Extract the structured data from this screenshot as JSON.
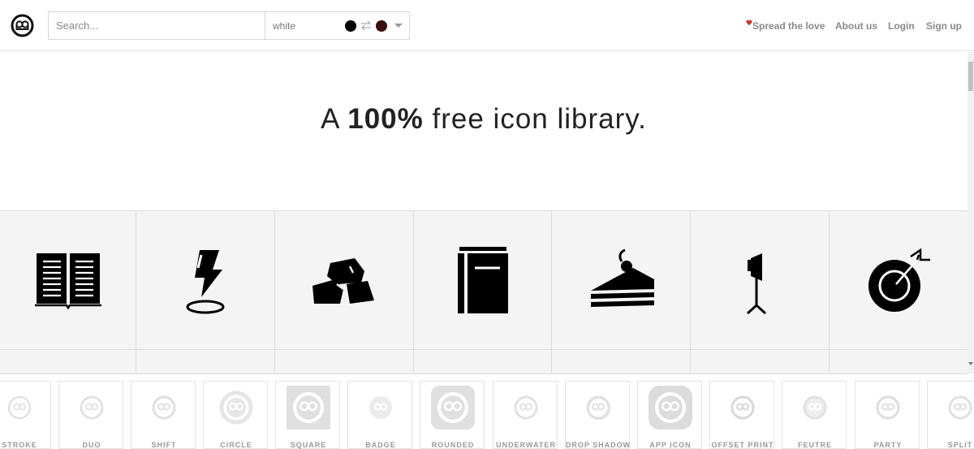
{
  "header": {
    "logo_icon": "circular-dual-loop-logo",
    "search": {
      "placeholder": "Search...",
      "value": ""
    },
    "color_picker": {
      "label": "white",
      "color_a": "#000000",
      "color_b": "#3a0c0c"
    },
    "nav": {
      "spread": "Spread the love",
      "about": "About us",
      "login": "Login",
      "signup": "Sign up"
    }
  },
  "hero": {
    "prefix": "A ",
    "bold": "100%",
    "suffix": " free icon library."
  },
  "icons": [
    {
      "name": "open-book-icon"
    },
    {
      "name": "lightning-marker-icon"
    },
    {
      "name": "rocks-icon"
    },
    {
      "name": "book-icon"
    },
    {
      "name": "cake-slice-icon"
    },
    {
      "name": "studio-light-icon"
    },
    {
      "name": "target-dart-icon"
    }
  ],
  "styles": [
    {
      "label": "STROKE"
    },
    {
      "label": "DUO"
    },
    {
      "label": "SHIFT"
    },
    {
      "label": "CIRCLE"
    },
    {
      "label": "SQUARE"
    },
    {
      "label": "BADGE"
    },
    {
      "label": "ROUNDED"
    },
    {
      "label": "UNDERWATER"
    },
    {
      "label": "DROP SHADOW"
    },
    {
      "label": "APP ICON"
    },
    {
      "label": "OFFSET PRINT"
    },
    {
      "label": "FEUTRE"
    },
    {
      "label": "PARTY"
    },
    {
      "label": "SPLIT"
    }
  ],
  "colors": {
    "accent_heart": "#c0392b",
    "nav_text": "#8a8a8a",
    "grid_bg": "#f4f4f4"
  }
}
